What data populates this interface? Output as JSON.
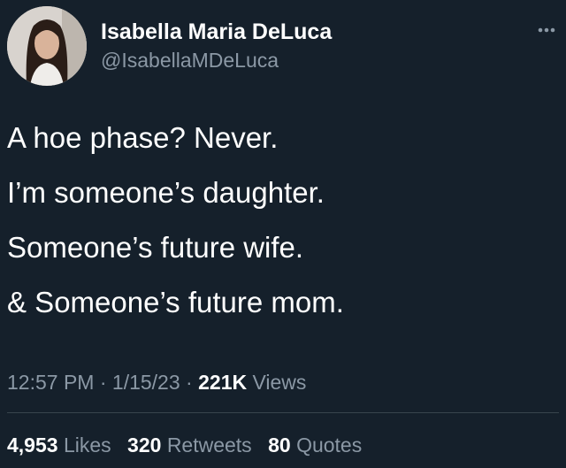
{
  "author": {
    "display_name": "Isabella Maria DeLuca",
    "handle": "@IsabellaMDeLuca"
  },
  "more_icon": "more-horizontal-icon",
  "tweet": {
    "lines": [
      "A hoe phase? Never.",
      "I’m someone’s daughter.",
      "Someone’s future wife.",
      "& Someone’s future mom."
    ]
  },
  "meta": {
    "time": "12:57 PM",
    "date": "1/15/23",
    "separator": "·",
    "views_count": "221K",
    "views_label": "Views"
  },
  "stats": {
    "likes_count": "4,953",
    "likes_label": "Likes",
    "retweets_count": "320",
    "retweets_label": "Retweets",
    "quotes_count": "80",
    "quotes_label": "Quotes"
  },
  "colors": {
    "background": "#15202b",
    "text_primary": "#ffffff",
    "text_secondary": "#8b98a5",
    "divider": "#38444d"
  }
}
